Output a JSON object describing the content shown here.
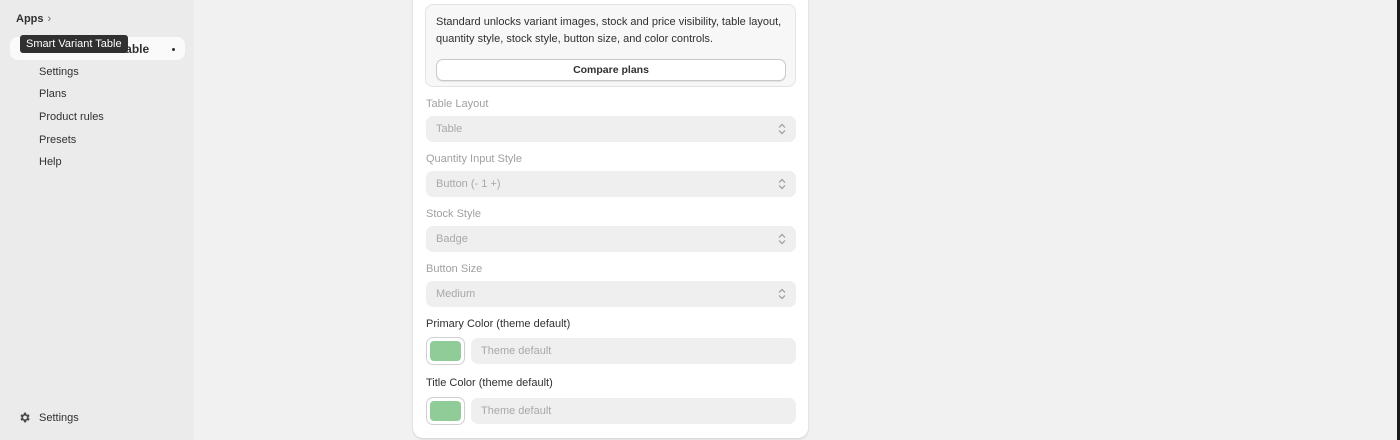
{
  "sidebar": {
    "apps_label": "Apps",
    "app_name": "Smart Variant Table",
    "tooltip": "Smart Variant Table",
    "nav": [
      "Settings",
      "Plans",
      "Product rules",
      "Presets",
      "Help"
    ],
    "bottom_settings": "Settings"
  },
  "upgrade": {
    "text": "Standard unlocks variant images, stock and price visibility, table layout, quantity style, stock style, button size, and color controls.",
    "compare_button": "Compare plans"
  },
  "fields": {
    "table_layout": {
      "label": "Table Layout",
      "value": "Table"
    },
    "quantity_style": {
      "label": "Quantity Input Style",
      "value": "Button (- 1 +)"
    },
    "stock_style": {
      "label": "Stock Style",
      "value": "Badge"
    },
    "button_size": {
      "label": "Button Size",
      "value": "Medium"
    },
    "primary_color": {
      "label": "Primary Color (theme default)",
      "placeholder": "Theme default",
      "swatch": "#8fcc98"
    },
    "title_color": {
      "label": "Title Color (theme default)",
      "placeholder": "Theme default",
      "swatch": "#8fcc98"
    }
  }
}
